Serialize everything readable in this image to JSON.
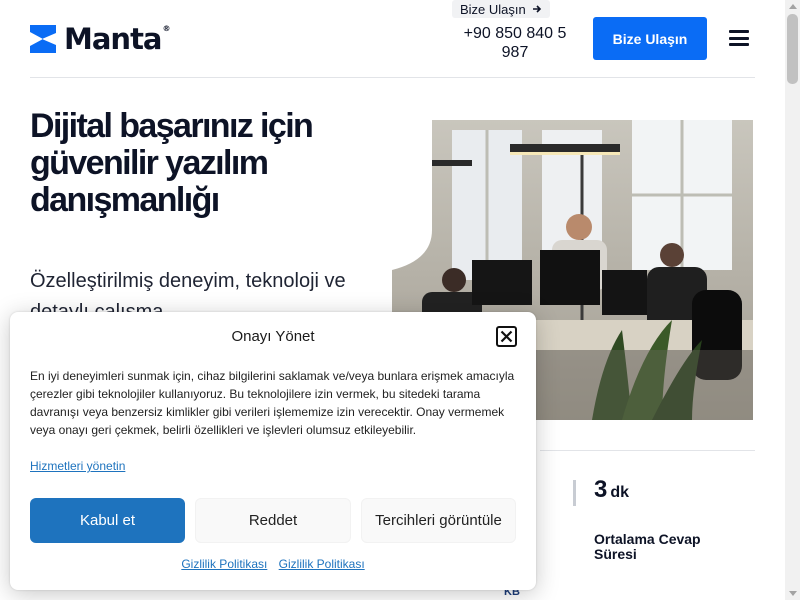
{
  "header": {
    "logo_text": "Manta",
    "logo_reg": "®",
    "top_contact_label": "Bize Ulaşın",
    "phone": "+90 850 840 5 987",
    "cta_label": "Bize Ulaşın"
  },
  "hero": {
    "title": "Dijital başarınız için güvenilir yazılım danışmanlığı",
    "subtitle": "Özelleştirilmiş deneyim, teknoloji ve detaylı çalışma"
  },
  "stats": {
    "value": "3",
    "unit": "dk",
    "label": "Ortalama Cevap Süresi",
    "partner_logo": "KB"
  },
  "consent": {
    "title": "Onayı Yönet",
    "body": "En iyi deneyimleri sunmak için, cihaz bilgilerini saklamak ve/veya bunlara erişmek amacıyla çerezler gibi teknolojiler kullanıyoruz. Bu teknolojilere izin vermek, bu sitedeki tarama davranışı veya benzersiz kimlikler gibi verileri işlememize izin verecektir. Onay vermemek veya onayı geri çekmek, belirli özellikleri ve işlevleri olumsuz etkileyebilir.",
    "manage_link": "Hizmetleri yönetin",
    "accept_label": "Kabul et",
    "deny_label": "Reddet",
    "prefs_label": "Tercihleri görüntüle",
    "policy_link_1": "Gizlilik Politikası",
    "policy_link_2": "Gizlilik Politikası"
  },
  "colors": {
    "brand_blue": "#0a6cf5",
    "consent_blue": "#1e73be",
    "text_dark": "#0d1326"
  },
  "icons": {
    "logo": "manta-logo-icon",
    "arrow": "arrow-right-icon",
    "menu": "hamburger-menu-icon",
    "close": "close-icon"
  }
}
